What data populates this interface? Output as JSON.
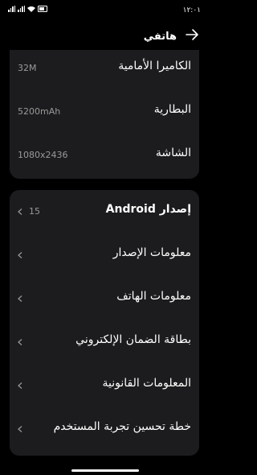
{
  "status_bar": {
    "time": "١٢:٠١"
  },
  "header": {
    "title": "هاتفي"
  },
  "specs": [
    {
      "label": "الكاميرا الأمامية",
      "value": "32M"
    },
    {
      "label": "البطارية",
      "value": "5200mAh"
    },
    {
      "label": "الشاشة",
      "value": "1080x2436"
    }
  ],
  "menu": [
    {
      "label": "إصدار Android",
      "value": "15"
    },
    {
      "label": "معلومات الإصدار"
    },
    {
      "label": "معلومات الهاتف"
    },
    {
      "label": "بطاقة الضمان الإلكتروني"
    },
    {
      "label": "المعلومات القانونية"
    },
    {
      "label": "خطة تحسين تجربة المستخدم"
    }
  ],
  "colors": {
    "background": "#000000",
    "card": "#1c1c1e",
    "secondary_text": "#9a9a9a"
  }
}
